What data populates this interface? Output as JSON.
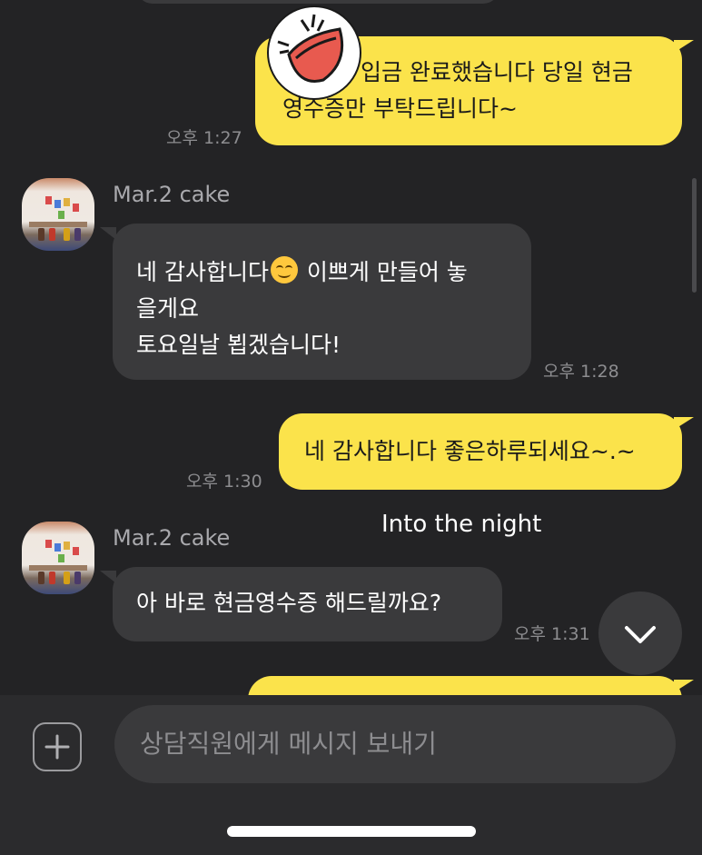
{
  "messages": [
    {
      "type": "outgoing",
      "lines": [
        "입금 완료했습니다 당일 현금",
        "영수증만 부탁드립니다~"
      ],
      "time": "오후 1:27"
    },
    {
      "type": "incoming",
      "sender": "Mar.2 cake",
      "lines": [
        "네 감사합니다",
        "이쁘게 만들어 놓",
        "을게요",
        "토요일날 뵙겠습니다!"
      ],
      "time": "오후 1:28"
    },
    {
      "type": "outgoing",
      "lines": [
        "네 감사합니다 좋은하루되세요~.~"
      ],
      "time": "오후 1:30"
    },
    {
      "type": "incoming",
      "sender": "Mar.2 cake",
      "lines": [
        "아 바로 현금영수증 해드릴까요?"
      ],
      "time": "오후 1:31"
    }
  ],
  "overlay_text": "Into the night",
  "input": {
    "placeholder": "상담직원에게 메시지 보내기"
  },
  "colors": {
    "background": "#232325",
    "outgoing_bubble": "#fbe34b",
    "incoming_bubble": "#3a3a3c",
    "time": "#8d8d90"
  },
  "icons": {
    "emoji": "smiling-face-emoji",
    "sticker": "laughing-sticker",
    "scroll": "chevron-down-icon",
    "attach": "plus-icon"
  }
}
